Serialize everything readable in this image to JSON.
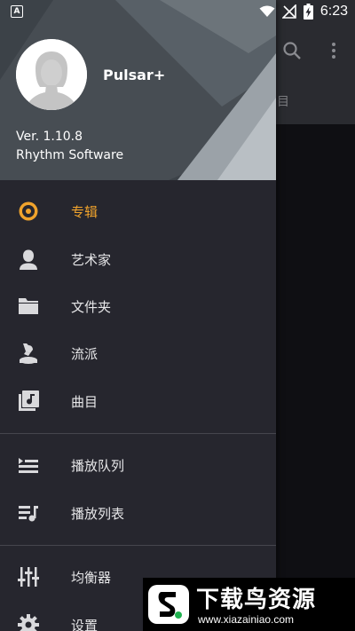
{
  "status_bar": {
    "app_badge": "A",
    "time": "6:23"
  },
  "background_app": {
    "tab_partial_label": "曲目"
  },
  "drawer": {
    "header": {
      "profile_name": "Pulsar+",
      "version": "Ver. 1.10.8",
      "company": "Rhythm Software"
    },
    "items": [
      {
        "label": "专辑",
        "icon": "album-icon",
        "active": true
      },
      {
        "label": "艺术家",
        "icon": "artist-icon"
      },
      {
        "label": "文件夹",
        "icon": "folder-icon"
      },
      {
        "label": "流派",
        "icon": "genre-icon"
      },
      {
        "label": "曲目",
        "icon": "songs-icon"
      },
      {
        "label": "播放队列",
        "icon": "queue-icon"
      },
      {
        "label": "播放列表",
        "icon": "playlist-icon"
      },
      {
        "label": "均衡器",
        "icon": "equalizer-icon"
      },
      {
        "label": "设置",
        "icon": "settings-icon"
      }
    ]
  },
  "watermark": {
    "title": "下载鸟资源",
    "url": "www.xiazainiao.com"
  },
  "colors": {
    "accent": "#f0a32c",
    "drawer_bg": "#26262e",
    "header_bg": "#41474d"
  }
}
